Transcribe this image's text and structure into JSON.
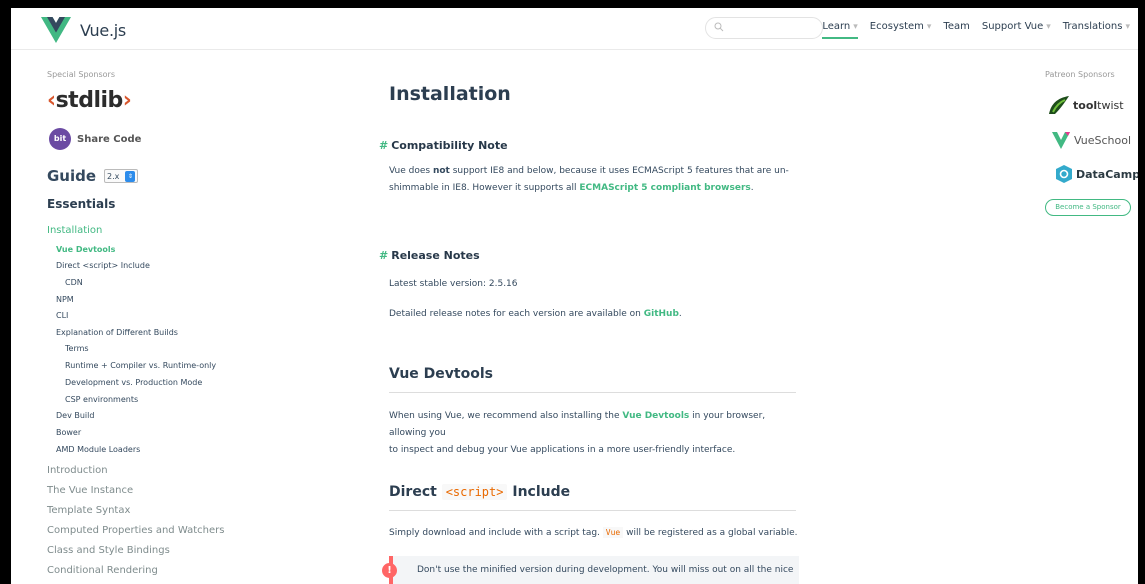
{
  "header": {
    "brand": "Vue.js",
    "search_placeholder": "",
    "nav": [
      {
        "label": "Learn",
        "has_caret": true,
        "active": true
      },
      {
        "label": "Ecosystem",
        "has_caret": true,
        "active": false
      },
      {
        "label": "Team",
        "has_caret": false,
        "active": false
      },
      {
        "label": "Support Vue",
        "has_caret": true,
        "active": false
      },
      {
        "label": "Translations",
        "has_caret": true,
        "active": false
      }
    ]
  },
  "sidebar": {
    "special_sponsors_label": "Special Sponsors",
    "stdlib_prefix": "‹",
    "stdlib_word": "stdlib",
    "stdlib_suffix": "›",
    "bit_badge": "bit",
    "bit_label": "Share Code",
    "guide_title": "Guide",
    "guide_version": "2.x",
    "essentials": "Essentials",
    "items": [
      {
        "label": "Installation",
        "level": "main",
        "active": true
      },
      {
        "label": "Vue Devtools",
        "level": "sub1",
        "active": true
      },
      {
        "label": "Direct <script> Include",
        "level": "sub1",
        "active": false
      },
      {
        "label": "CDN",
        "level": "sub2",
        "active": false
      },
      {
        "label": "NPM",
        "level": "sub1",
        "active": false
      },
      {
        "label": "CLI",
        "level": "sub1",
        "active": false
      },
      {
        "label": "Explanation of Different Builds",
        "level": "sub1",
        "active": false
      },
      {
        "label": "Terms",
        "level": "sub2",
        "active": false
      },
      {
        "label": "Runtime + Compiler vs. Runtime-only",
        "level": "sub2",
        "active": false
      },
      {
        "label": "Development vs. Production Mode",
        "level": "sub2",
        "active": false
      },
      {
        "label": "CSP environments",
        "level": "sub2",
        "active": false
      },
      {
        "label": "Dev Build",
        "level": "sub1",
        "active": false
      },
      {
        "label": "Bower",
        "level": "sub1",
        "active": false
      },
      {
        "label": "AMD Module Loaders",
        "level": "sub1",
        "active": false
      },
      {
        "label": "Introduction",
        "level": "main",
        "active": false
      },
      {
        "label": "The Vue Instance",
        "level": "main",
        "active": false
      },
      {
        "label": "Template Syntax",
        "level": "main",
        "active": false
      },
      {
        "label": "Computed Properties and Watchers",
        "level": "main",
        "active": false
      },
      {
        "label": "Class and Style Bindings",
        "level": "main",
        "active": false
      },
      {
        "label": "Conditional Rendering",
        "level": "main",
        "active": false
      }
    ]
  },
  "content": {
    "page_title": "Installation",
    "compat_heading": "Compatibility Note",
    "compat_p1_pre": "Vue does ",
    "compat_p1_bold": "not",
    "compat_p1_post": " support IE8 and below, because it uses ECMAScript 5 features that are un-",
    "compat_p2_pre": "shimmable in IE8. However it supports all ",
    "compat_p2_link": "ECMAScript 5 compliant browsers",
    "compat_p2_post": ".",
    "release_heading": "Release Notes",
    "release_version": "Latest stable version: 2.5.16",
    "release_detail_pre": "Detailed release notes for each version are available on ",
    "release_detail_link": "GitHub",
    "release_detail_post": ".",
    "devtools_heading": "Vue Devtools",
    "devtools_p1_pre": "When using Vue, we recommend also installing the ",
    "devtools_p1_link": "Vue Devtools",
    "devtools_p1_post": " in your browser, allowing you",
    "devtools_p2": "to inspect and debug your Vue applications in a more user-friendly interface.",
    "direct_heading_pre": "Direct ",
    "direct_heading_code": "<script>",
    "direct_heading_post": " Include",
    "direct_p_pre": "Simply download and include with a script tag. ",
    "direct_p_code": "Vue",
    "direct_p_post": " will be registered as a global variable.",
    "tip_badge": "!",
    "tip_text": "Don't use the minified version during development. You will miss out on all the nice"
  },
  "right": {
    "patreon_label": "Patreon Sponsors",
    "sponsor1_bold": "tool",
    "sponsor1_rest": "twist",
    "sponsor2": "VueSchool",
    "sponsor3": "DataCamp",
    "become_button": "Become a Sponsor"
  },
  "colors": {
    "accent": "#42b983",
    "warning": "#ff6666",
    "code": "#e96900",
    "select_arrows": "#2d8ceb"
  }
}
